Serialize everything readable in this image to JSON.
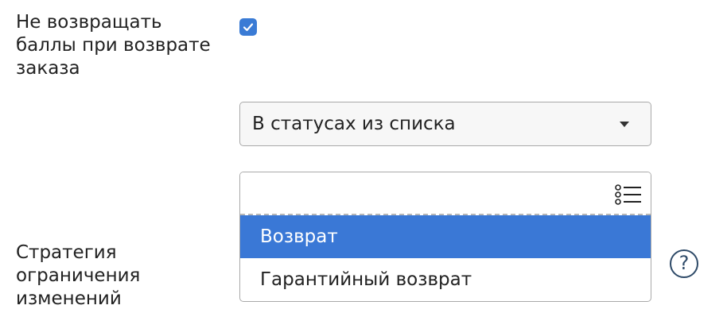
{
  "no_return_points": {
    "label": "Не возвращать баллы при возврате заказа",
    "checked": true
  },
  "status_select": {
    "value": "В статусах из списка"
  },
  "status_multiselect": {
    "options": [
      {
        "label": "Возврат",
        "selected": true
      },
      {
        "label": "Гарантийный возврат",
        "selected": false
      }
    ]
  },
  "strategy": {
    "label": "Стратегия ограничения изменений"
  },
  "help": {
    "symbol": "?"
  },
  "icons": {
    "checkbox": "checkmark-icon",
    "select_caret": "caret-down-icon",
    "list": "list-icon",
    "help": "question-circle-icon"
  },
  "colors": {
    "accent": "#3a7bd5",
    "selected_option": "#3a78d6",
    "help_icon": "#2e4a68"
  }
}
